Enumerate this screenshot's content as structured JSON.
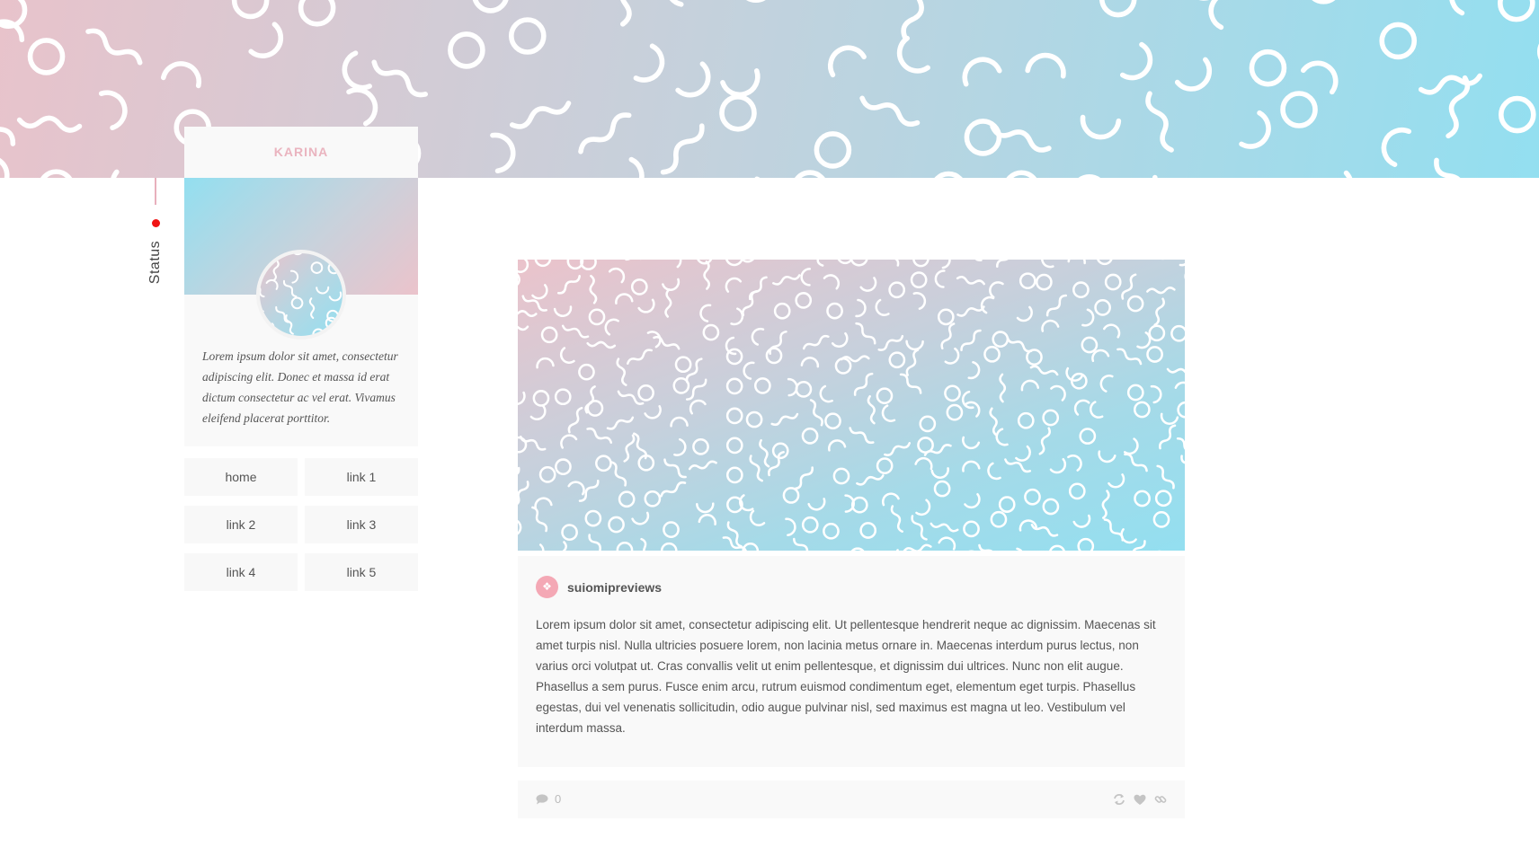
{
  "sidebar": {
    "status_label": "Status",
    "status_color": "#f01414",
    "profile": {
      "name": "KARINA",
      "description": "Lorem ipsum dolor sit amet, consectetur adipiscing elit. Donec et massa id erat dictum consectetur ac vel erat. Vivamus eleifend placerat porttitor."
    },
    "nav": [
      {
        "label": "home"
      },
      {
        "label": "link 1"
      },
      {
        "label": "link 2"
      },
      {
        "label": "link 3"
      },
      {
        "label": "link 4"
      },
      {
        "label": "link 5"
      }
    ]
  },
  "post": {
    "author": "suiomipreviews",
    "author_avatar_icon": "bird-icon",
    "text": "Lorem ipsum dolor sit amet, consectetur adipiscing elit. Ut pellentesque hendrerit neque ac dignissim. Maecenas sit amet turpis nisl. Nulla ultricies posuere lorem, non lacinia metus ornare in. Maecenas interdum purus lectus, non varius orci volutpat ut. Cras convallis velit ut enim pellentesque, et dignissim dui ultrices. Nunc non elit augue. Phasellus a sem purus. Fusce enim arcu, rutrum euismod condimentum eget, elementum eget turpis. Phasellus egestas, dui vel venenatis sollicitudin, odio augue pulvinar nisl, sed maximus est magna ut leo. Vestibulum vel interdum massa.",
    "comment_count": "0",
    "actions": [
      "reblog-icon",
      "heart-icon",
      "link-icon"
    ]
  },
  "colors": {
    "accent_pink": "#eab4bf",
    "accent_blue": "#93dff0"
  }
}
